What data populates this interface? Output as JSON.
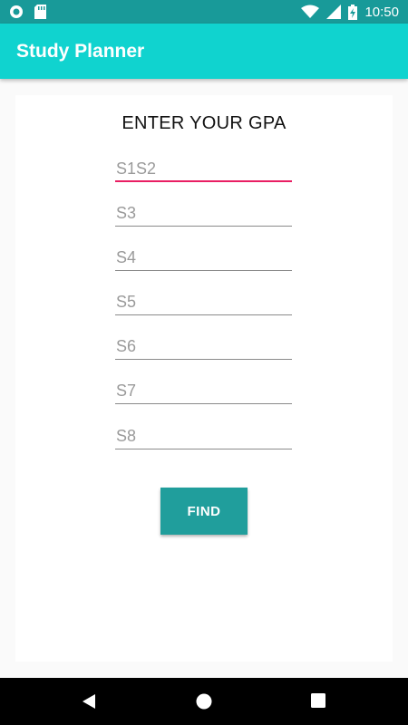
{
  "status_bar": {
    "time": "10:50",
    "left_icons": [
      "circle-notification-icon",
      "sd-card-icon"
    ],
    "right_icons": [
      "wifi-icon",
      "cell-signal-icon",
      "battery-charging-icon"
    ]
  },
  "app_bar": {
    "title": "Study Planner",
    "color": "#10d3cf"
  },
  "form": {
    "heading": "ENTER YOUR GPA",
    "fields": [
      {
        "placeholder": "S1S2",
        "value": ""
      },
      {
        "placeholder": "S3",
        "value": ""
      },
      {
        "placeholder": "S4",
        "value": ""
      },
      {
        "placeholder": "S5",
        "value": ""
      },
      {
        "placeholder": "S6",
        "value": ""
      },
      {
        "placeholder": "S7",
        "value": ""
      },
      {
        "placeholder": "S8",
        "value": ""
      }
    ],
    "focused_field": "S1S2",
    "find_label": "FIND",
    "accent_color": "#e91e63",
    "button_color": "#209e9c"
  },
  "nav_bar": {
    "buttons": [
      "back-icon",
      "home-icon",
      "recents-icon"
    ]
  }
}
